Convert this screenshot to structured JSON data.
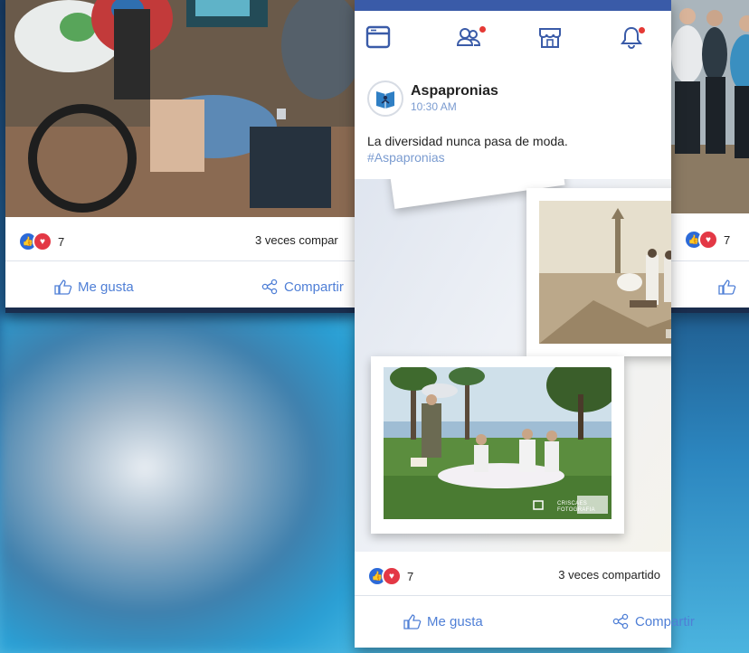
{
  "left_card": {
    "reaction_count": "7",
    "shares": "3 veces compar",
    "like_label": "Me gusta",
    "share_label": "Compartir"
  },
  "center_card": {
    "author": "Aspapronias",
    "time": "10:30 AM",
    "text": "La diversidad nunca pasa de moda.",
    "hashtag": "#Aspapronias",
    "photo_watermark": "CRISCAES FOTOGRAFIA",
    "reaction_count": "7",
    "shares": "3 veces compartido",
    "like_label": "Me gusta",
    "share_label": "Compartir"
  },
  "right_card": {
    "reaction_count": "7"
  },
  "icons": {
    "nav": [
      "browser-icon",
      "friends-icon",
      "store-icon",
      "bell-icon"
    ],
    "reactions": [
      "like-reaction-icon",
      "love-reaction-icon"
    ]
  },
  "colors": {
    "accent": "#3a5ba8",
    "link": "#4f7fd6",
    "notification": "#e53935",
    "like": "#2c6ad8",
    "love": "#e33845"
  }
}
